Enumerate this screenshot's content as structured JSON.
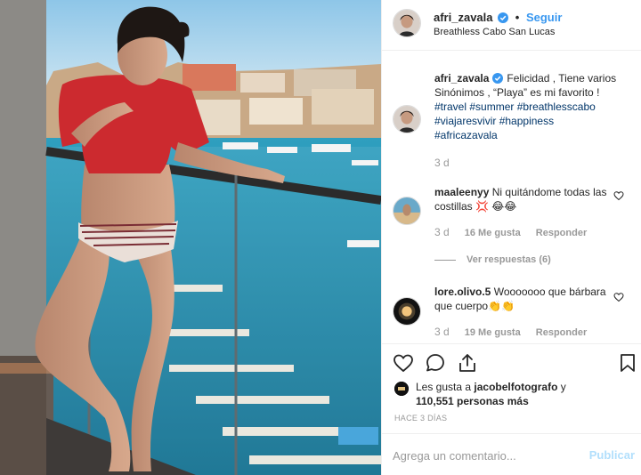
{
  "post": {
    "username": "afri_zavala",
    "follow_label": "Seguir",
    "separator": "•",
    "location": "Breathless Cabo San Lucas"
  },
  "caption": {
    "username": "afri_zavala",
    "text": "Felicidad , Tiene varios Sinónimos , “Playa” es mi favorito !",
    "hashtags": [
      "#travel",
      "#summer",
      "#breathlesscabo",
      "#viajaresvivir",
      "#happiness",
      "#africazavala"
    ],
    "time": "3 d"
  },
  "comments": [
    {
      "username": "maaleenyy",
      "text": "Ni quitándome todas las costillas 💢 😂😂",
      "time": "3 d",
      "likes": "16 Me gusta",
      "reply_label": "Responder",
      "view_replies": "Ver respuestas (6)"
    },
    {
      "username": "lore.olivo.5",
      "text": "Wooooooo que bárbara que cuerpo👏👏",
      "time": "3 d",
      "likes": "19 Me gusta",
      "reply_label": "Responder"
    }
  ],
  "likes_summary": {
    "prefix": "Les gusta a",
    "user": "jacobelfotografo",
    "middle": "y",
    "count": "110,551 personas más"
  },
  "posted_ago": "HACE 3 DÍAS",
  "comment_box": {
    "placeholder": "Agrega un comentario...",
    "publish_label": "Publicar"
  },
  "icons": {
    "like": "heart-icon",
    "comment": "comment-icon",
    "share": "share-icon",
    "save": "bookmark-icon",
    "verified": "verified-badge-icon"
  },
  "colors": {
    "accent": "#3897f0",
    "publish_disabled": "#b2dffc",
    "hashtag": "#003569",
    "muted": "#999999",
    "border": "#efefef"
  }
}
